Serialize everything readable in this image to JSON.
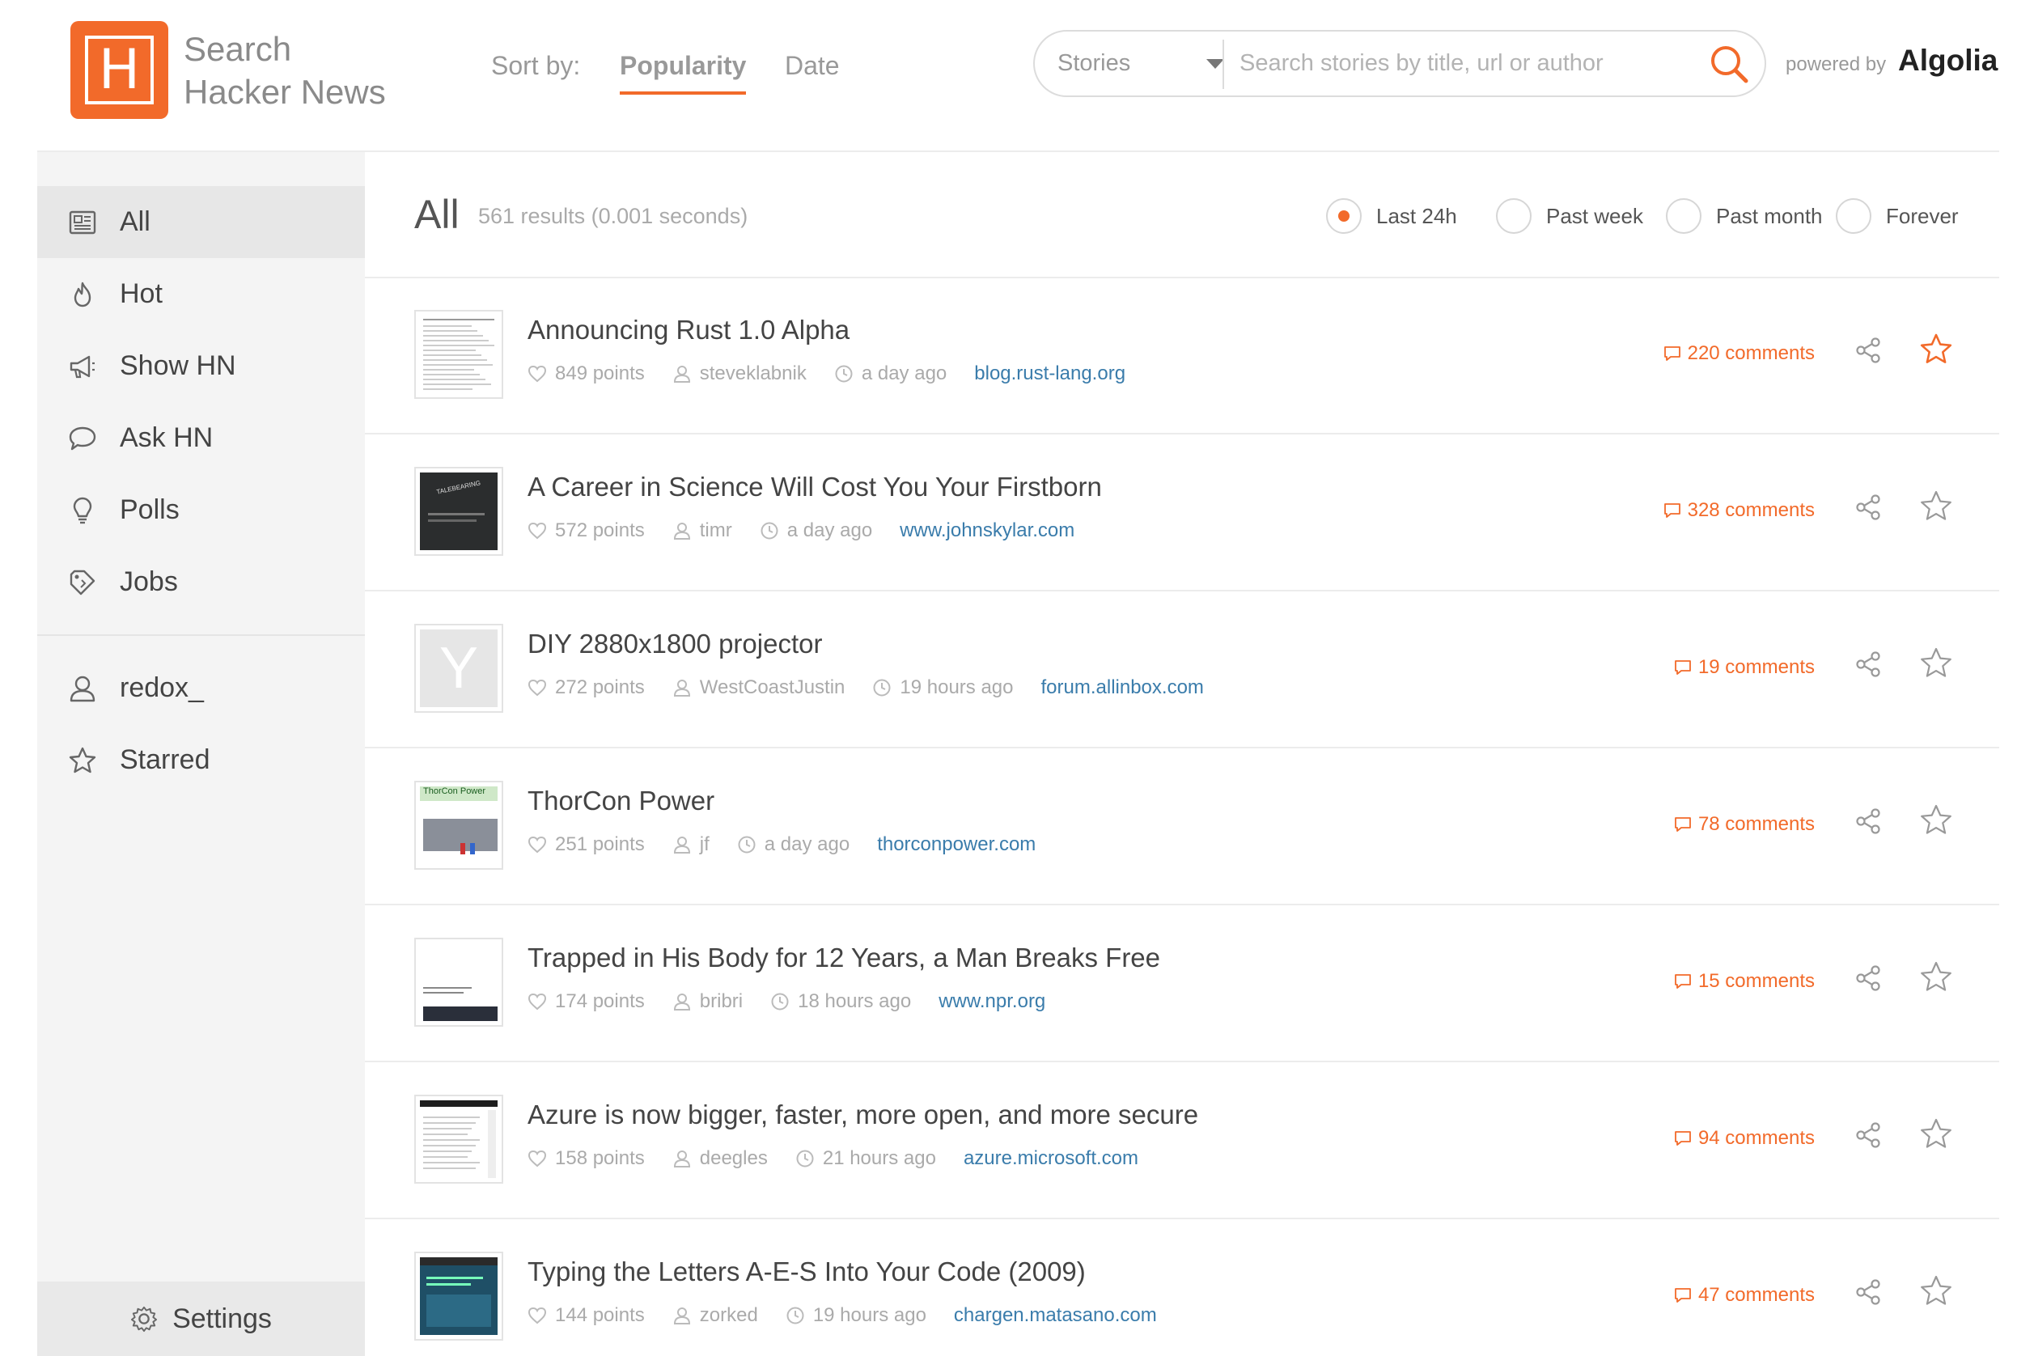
{
  "header": {
    "logo_letter": "H",
    "brand_line1": "Search",
    "brand_line2": "Hacker News",
    "sort_label": "Sort by:",
    "sort_options": [
      "Popularity",
      "Date"
    ],
    "search_scope": "Stories",
    "search_placeholder": "Search stories by title, url or author",
    "powered_by": "powered by",
    "algolia": "Algolia"
  },
  "colors": {
    "accent": "#f26a2a",
    "link": "#3a7cab"
  },
  "sidebar": {
    "items": [
      {
        "label": "All",
        "icon": "newspaper-icon"
      },
      {
        "label": "Hot",
        "icon": "flame-icon"
      },
      {
        "label": "Show HN",
        "icon": "megaphone-icon"
      },
      {
        "label": "Ask HN",
        "icon": "speech-bubble-icon"
      },
      {
        "label": "Polls",
        "icon": "lightbulb-icon"
      },
      {
        "label": "Jobs",
        "icon": "tag-icon"
      }
    ],
    "user_items": [
      {
        "label": "redox_",
        "icon": "user-icon"
      },
      {
        "label": "Starred",
        "icon": "star-icon"
      }
    ],
    "settings_label": "Settings"
  },
  "main": {
    "title": "All",
    "results": "561 results (0.001 seconds)",
    "time_filters": [
      "Last 24h",
      "Past week",
      "Past month",
      "Forever"
    ],
    "selected_filter": "Last 24h"
  },
  "stories": [
    {
      "title": "Announcing Rust 1.0 Alpha",
      "points": "849 points",
      "author": "steveklabnik",
      "time": "a day ago",
      "url": "blog.rust-lang.org",
      "comments": "220 comments",
      "starred": true
    },
    {
      "title": "A Career in Science Will Cost You Your Firstborn",
      "points": "572 points",
      "author": "timr",
      "time": "a day ago",
      "url": "www.johnskylar.com",
      "comments": "328 comments",
      "starred": false
    },
    {
      "title": "DIY 2880x1800 projector",
      "points": "272 points",
      "author": "WestCoastJustin",
      "time": "19 hours ago",
      "url": "forum.allinbox.com",
      "comments": "19 comments",
      "starred": false
    },
    {
      "title": "ThorCon Power",
      "points": "251 points",
      "author": "jf",
      "time": "a day ago",
      "url": "thorconpower.com",
      "comments": "78 comments",
      "starred": false
    },
    {
      "title": "Trapped in His Body for 12 Years, a Man Breaks Free",
      "points": "174 points",
      "author": "bribri",
      "time": "18 hours ago",
      "url": "www.npr.org",
      "comments": "15 comments",
      "starred": false
    },
    {
      "title": "Azure is now bigger, faster, more open, and more secure",
      "points": "158 points",
      "author": "deegles",
      "time": "21 hours ago",
      "url": "azure.microsoft.com",
      "comments": "94 comments",
      "starred": false
    },
    {
      "title": "Typing the Letters A-E-S Into Your Code (2009)",
      "points": "144 points",
      "author": "zorked",
      "time": "19 hours ago",
      "url": "chargen.matasano.com",
      "comments": "47 comments",
      "starred": false
    }
  ],
  "thumb_labels": {
    "science": "TALEBEARING",
    "diy": "Y",
    "thorcon": "ThorCon Power"
  }
}
